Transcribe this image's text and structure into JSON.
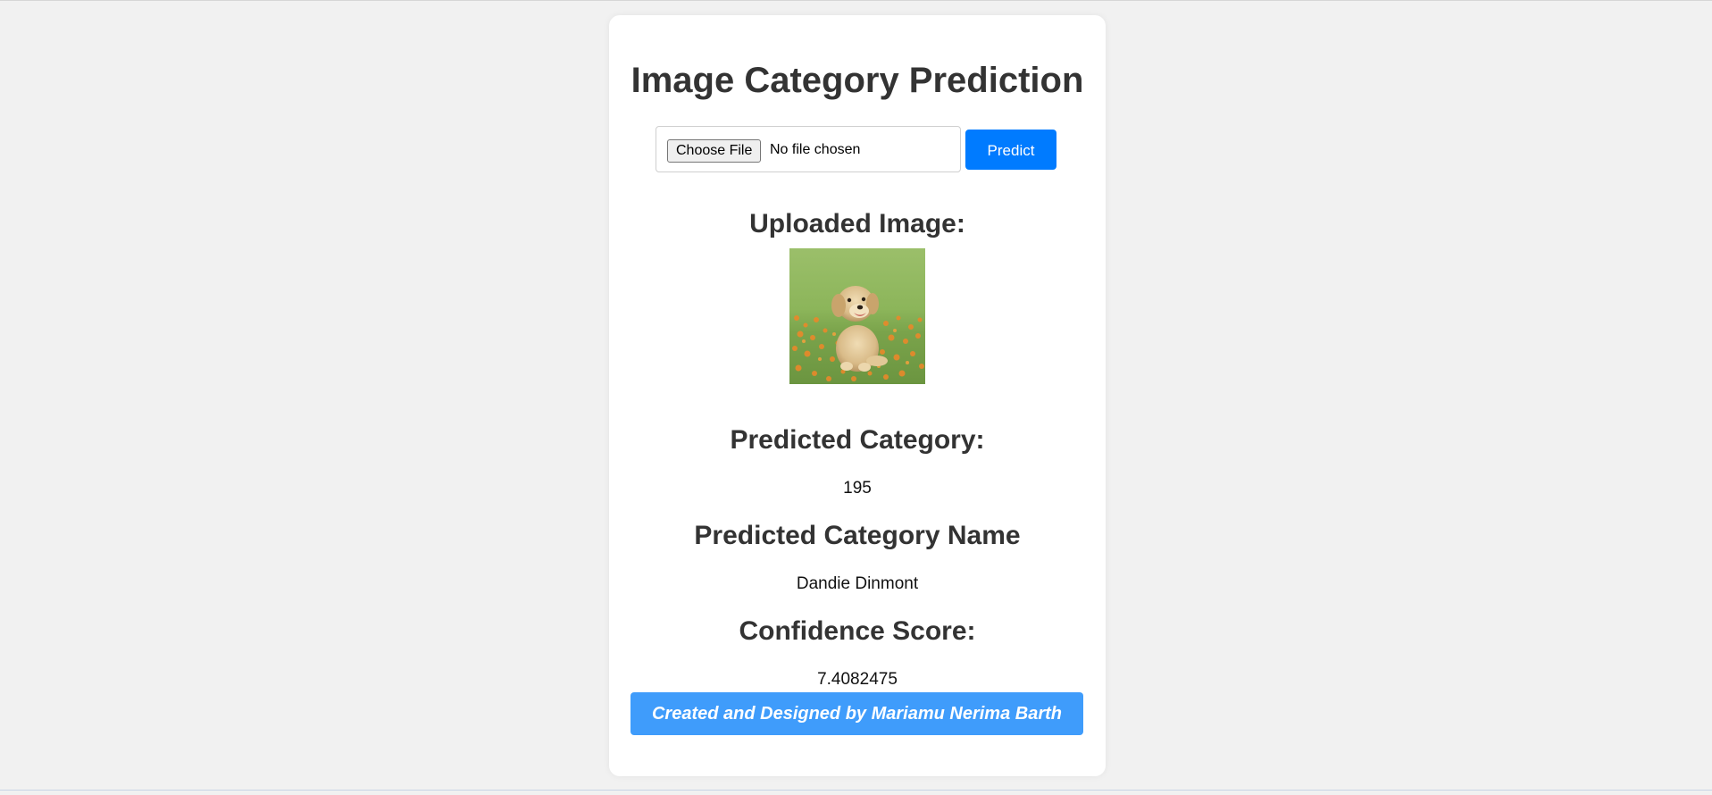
{
  "page": {
    "title": "Image Category Prediction"
  },
  "upload": {
    "choose_file_label": "Choose File",
    "file_status": "No file chosen",
    "predict_label": "Predict"
  },
  "uploaded_image": {
    "heading": "Uploaded Image:",
    "subject": "puppy sitting on grass with orange flowers"
  },
  "results": {
    "category_heading": "Predicted Category:",
    "category_value": "195",
    "category_name_heading": "Predicted Category Name",
    "category_name_value": "Dandie Dinmont",
    "confidence_heading": "Confidence Score:",
    "confidence_value": "7.4082475"
  },
  "footer": {
    "credit": "Created and Designed by Mariamu Nerima Barth"
  },
  "colors": {
    "page_background": "#f1f1f1",
    "card_background": "#ffffff",
    "predict_button": "#007bff",
    "footer_bar": "#3f9cfb",
    "heading_text": "#333333"
  }
}
